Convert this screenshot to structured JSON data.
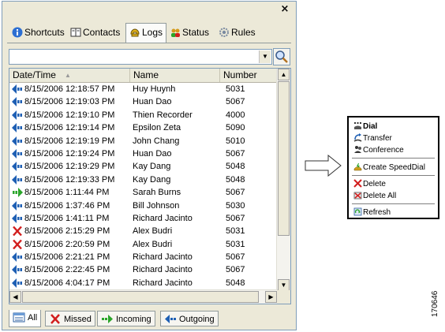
{
  "window": {
    "close_label": "×"
  },
  "tabs": [
    {
      "label": "Shortcuts",
      "icon": "info-icon"
    },
    {
      "label": "Contacts",
      "icon": "address-book-icon"
    },
    {
      "label": "Logs",
      "icon": "phone-log-icon",
      "active": true
    },
    {
      "label": "Status",
      "icon": "people-status-icon"
    },
    {
      "label": "Rules",
      "icon": "gear-icon"
    }
  ],
  "search": {
    "value": "",
    "dropdown_glyph": "▼"
  },
  "table": {
    "columns": [
      "Date/Time",
      "Name",
      "Number"
    ],
    "sort_glyph": "▲",
    "rows": [
      {
        "type": "received",
        "datetime": "8/15/2006 12:18:57 PM",
        "name": "Huy Huynh",
        "number": "5031"
      },
      {
        "type": "received",
        "datetime": "8/15/2006 12:19:03 PM",
        "name": "Huan Dao",
        "number": "5067"
      },
      {
        "type": "received",
        "datetime": "8/15/2006 12:19:10 PM",
        "name": "Thien Recorder",
        "number": "4000"
      },
      {
        "type": "received",
        "datetime": "8/15/2006 12:19:14 PM",
        "name": "Epsilon Zeta",
        "number": "5090"
      },
      {
        "type": "received",
        "datetime": "8/15/2006 12:19:19 PM",
        "name": "John Chang",
        "number": "5010"
      },
      {
        "type": "received",
        "datetime": "8/15/2006 12:19:24 PM",
        "name": "Huan Dao",
        "number": "5067"
      },
      {
        "type": "received",
        "datetime": "8/15/2006 12:19:29 PM",
        "name": "Kay Dang",
        "number": "5048"
      },
      {
        "type": "received",
        "datetime": "8/15/2006 12:19:33 PM",
        "name": "Kay Dang",
        "number": "5048"
      },
      {
        "type": "outgoing",
        "datetime": "8/15/2006 1:11:44 PM",
        "name": "Sarah Burns",
        "number": "5067"
      },
      {
        "type": "received",
        "datetime": "8/15/2006 1:37:46 PM",
        "name": "Bill Johnson",
        "number": "5030"
      },
      {
        "type": "received",
        "datetime": "8/15/2006 1:41:11 PM",
        "name": "Richard Jacinto",
        "number": "5067"
      },
      {
        "type": "missed",
        "datetime": "8/15/2006 2:15:29 PM",
        "name": "Alex Budri",
        "number": "5031"
      },
      {
        "type": "missed",
        "datetime": "8/15/2006 2:20:59 PM",
        "name": "Alex Budri",
        "number": "5031"
      },
      {
        "type": "received",
        "datetime": "8/15/2006 2:21:21 PM",
        "name": "Richard Jacinto",
        "number": "5067"
      },
      {
        "type": "received",
        "datetime": "8/15/2006 2:22:45 PM",
        "name": "Richard Jacinto",
        "number": "5067"
      },
      {
        "type": "received",
        "datetime": "8/15/2006 4:04:17 PM",
        "name": "Richard Jacinto",
        "number": "5048"
      }
    ]
  },
  "scroll": {
    "up": "▲",
    "down": "▼",
    "left": "◀",
    "right": "▶"
  },
  "filter_tabs": [
    {
      "label": "All",
      "icon": "all-calls-icon",
      "active": true
    },
    {
      "label": "Missed",
      "icon": "missed-icon"
    },
    {
      "label": "Incoming",
      "icon": "incoming-icon"
    },
    {
      "label": "Outgoing",
      "icon": "outgoing-icon"
    }
  ],
  "context_menu": {
    "items": [
      {
        "label": "Dial",
        "icon": "dial-icon",
        "bold": true
      },
      {
        "label": "Transfer",
        "icon": "transfer-icon"
      },
      {
        "label": "Conference",
        "icon": "conference-icon"
      },
      {
        "label": "Create SpeedDial",
        "icon": "speeddial-icon"
      },
      {
        "label": "Delete",
        "icon": "delete-icon"
      },
      {
        "label": "Delete All",
        "icon": "delete-all-icon"
      },
      {
        "label": "Refresh",
        "icon": "refresh-icon"
      }
    ]
  },
  "figure_id": "170646",
  "colors": {
    "received": "#1e5fb4",
    "outgoing": "#2aa52a",
    "missed": "#d21e1e",
    "frame": "#ece9d8",
    "border": "#7f9db9"
  }
}
